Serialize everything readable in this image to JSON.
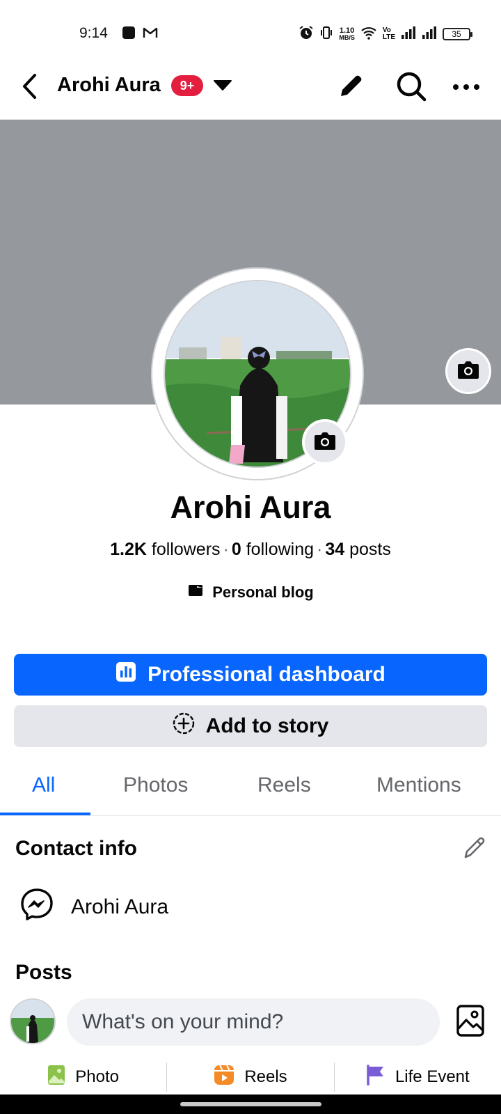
{
  "status_bar": {
    "time": "9:14",
    "speed_top": "1.10",
    "speed_bottom": "MB/S",
    "volte_top": "Vo",
    "volte_bottom": "LTE",
    "battery": "35",
    "icons": [
      "app-square-icon",
      "gmail-icon",
      "alarm-icon",
      "vibrate-icon",
      "wifi-icon",
      "signal-icon",
      "signal-icon"
    ]
  },
  "header": {
    "title": "Arohi Aura",
    "badge": "9+",
    "icons": [
      "back-arrow-icon",
      "caret-down-icon",
      "pencil-icon",
      "search-icon",
      "more-icon"
    ]
  },
  "profile": {
    "name": "Arohi Aura",
    "followers_count": "1.2K",
    "followers_label": "followers",
    "following_count": "0",
    "following_label": "following",
    "posts_count": "34",
    "posts_label": "posts",
    "separator": "·",
    "category": "Personal blog"
  },
  "buttons": {
    "dashboard": "Professional dashboard",
    "add_story": "Add to story"
  },
  "tabs": [
    {
      "label": "All",
      "active": true
    },
    {
      "label": "Photos",
      "active": false
    },
    {
      "label": "Reels",
      "active": false
    },
    {
      "label": "Mentions",
      "active": false
    }
  ],
  "contact_info": {
    "title": "Contact info",
    "messenger_name": "Arohi Aura"
  },
  "posts": {
    "title": "Posts",
    "composer_placeholder": "What's on your mind?",
    "actions": [
      {
        "label": "Photo",
        "icon": "photo-icon"
      },
      {
        "label": "Reels",
        "icon": "reels-icon"
      },
      {
        "label": "Life Event",
        "icon": "flag-icon"
      }
    ]
  },
  "colors": {
    "brand_blue": "#0866ff",
    "badge_red": "#e41e3f",
    "cover_gray": "#95989c",
    "button_gray": "#e4e6eb"
  }
}
